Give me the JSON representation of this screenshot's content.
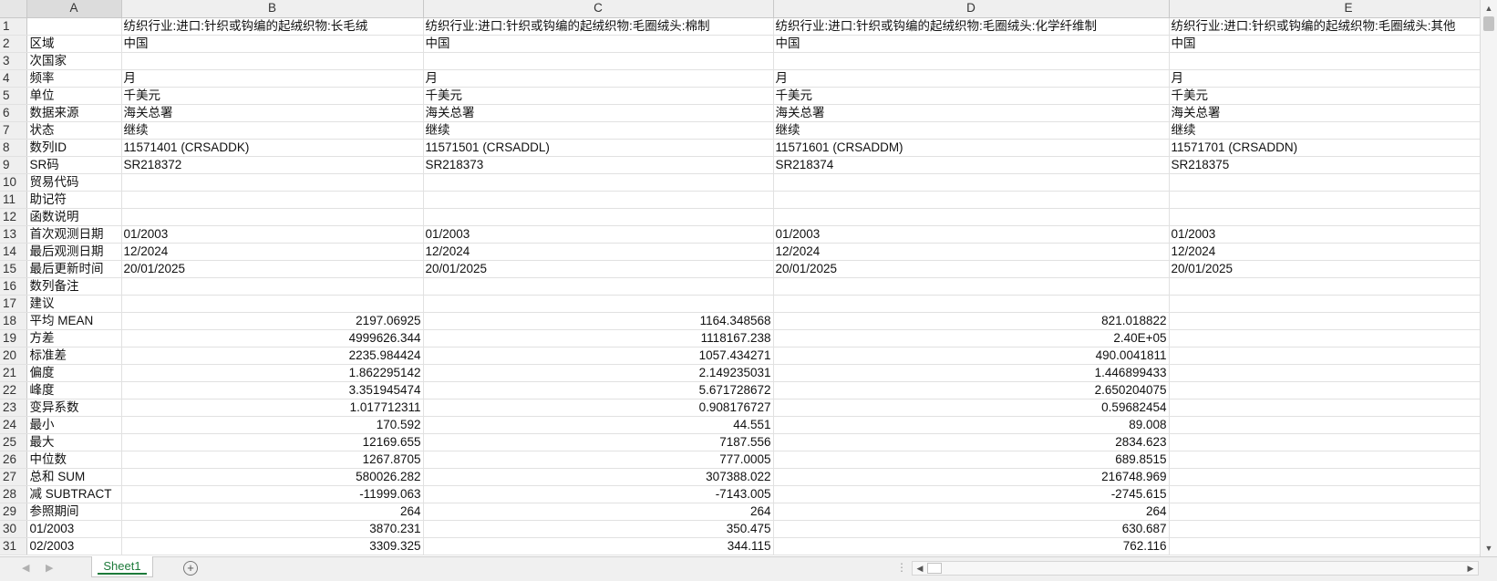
{
  "columns": [
    "A",
    "B",
    "C",
    "D",
    "E"
  ],
  "rows": [
    {
      "num": "1",
      "a": "",
      "b": "纺织行业:进口:针织或钩编的起绒织物:长毛绒",
      "c": "纺织行业:进口:针织或钩编的起绒织物:毛圈绒头:棉制",
      "d": "纺织行业:进口:针织或钩编的起绒织物:毛圈绒头:化学纤维制",
      "e": "纺织行业:进口:针织或钩编的起绒织物:毛圈绒头:其他"
    },
    {
      "num": "2",
      "a": "区域",
      "b": "中国",
      "c": "中国",
      "d": "中国",
      "e": "中国"
    },
    {
      "num": "3",
      "a": "次国家",
      "b": "",
      "c": "",
      "d": "",
      "e": ""
    },
    {
      "num": "4",
      "a": "频率",
      "b": "月",
      "c": "月",
      "d": "月",
      "e": "月"
    },
    {
      "num": "5",
      "a": "单位",
      "b": "千美元",
      "c": "千美元",
      "d": "千美元",
      "e": "千美元"
    },
    {
      "num": "6",
      "a": "数据来源",
      "b": "海关总署",
      "c": "海关总署",
      "d": "海关总署",
      "e": "海关总署"
    },
    {
      "num": "7",
      "a": "状态",
      "b": "继续",
      "c": "继续",
      "d": "继续",
      "e": "继续"
    },
    {
      "num": "8",
      "a": "数列ID",
      "b": "11571401 (CRSADDK)",
      "c": "11571501 (CRSADDL)",
      "d": "11571601 (CRSADDM)",
      "e": "11571701 (CRSADDN)"
    },
    {
      "num": "9",
      "a": "SR码",
      "b": "SR218372",
      "c": "SR218373",
      "d": "SR218374",
      "e": "SR218375"
    },
    {
      "num": "10",
      "a": "贸易代码",
      "b": "",
      "c": "",
      "d": "",
      "e": ""
    },
    {
      "num": "11",
      "a": "助记符",
      "b": "",
      "c": "",
      "d": "",
      "e": ""
    },
    {
      "num": "12",
      "a": "函数说明",
      "b": "",
      "c": "",
      "d": "",
      "e": ""
    },
    {
      "num": "13",
      "a": "首次观测日期",
      "b": "01/2003",
      "c": "01/2003",
      "d": "01/2003",
      "e": "01/2003"
    },
    {
      "num": "14",
      "a": "最后观测日期",
      "b": "12/2024",
      "c": "12/2024",
      "d": "12/2024",
      "e": "12/2024"
    },
    {
      "num": "15",
      "a": "最后更新时间",
      "b": "20/01/2025",
      "c": "20/01/2025",
      "d": "20/01/2025",
      "e": "20/01/2025"
    },
    {
      "num": "16",
      "a": "数列备注",
      "b": "",
      "c": "",
      "d": "",
      "e": ""
    },
    {
      "num": "17",
      "a": "建议",
      "b": "",
      "c": "",
      "d": "",
      "e": ""
    },
    {
      "num": "18",
      "a": "平均 MEAN",
      "b": "2197.06925",
      "c": "1164.348568",
      "d": "821.018822",
      "e": "",
      "numeric": true
    },
    {
      "num": "19",
      "a": "方差",
      "b": "4999626.344",
      "c": "1118167.238",
      "d": "2.40E+05",
      "e": "",
      "numeric": true
    },
    {
      "num": "20",
      "a": "标准差",
      "b": "2235.984424",
      "c": "1057.434271",
      "d": "490.0041811",
      "e": "",
      "numeric": true
    },
    {
      "num": "21",
      "a": "偏度",
      "b": "1.862295142",
      "c": "2.149235031",
      "d": "1.446899433",
      "e": "",
      "numeric": true
    },
    {
      "num": "22",
      "a": "峰度",
      "b": "3.351945474",
      "c": "5.671728672",
      "d": "2.650204075",
      "e": "",
      "numeric": true
    },
    {
      "num": "23",
      "a": "变异系数",
      "b": "1.017712311",
      "c": "0.908176727",
      "d": "0.59682454",
      "e": "",
      "numeric": true
    },
    {
      "num": "24",
      "a": "最小",
      "b": "170.592",
      "c": "44.551",
      "d": "89.008",
      "e": "",
      "numeric": true
    },
    {
      "num": "25",
      "a": "最大",
      "b": "12169.655",
      "c": "7187.556",
      "d": "2834.623",
      "e": "",
      "numeric": true
    },
    {
      "num": "26",
      "a": "中位数",
      "b": "1267.8705",
      "c": "777.0005",
      "d": "689.8515",
      "e": "",
      "numeric": true
    },
    {
      "num": "27",
      "a": "总和 SUM",
      "b": "580026.282",
      "c": "307388.022",
      "d": "216748.969",
      "e": "",
      "numeric": true
    },
    {
      "num": "28",
      "a": "减 SUBTRACT",
      "b": "-11999.063",
      "c": "-7143.005",
      "d": "-2745.615",
      "e": "",
      "numeric": true
    },
    {
      "num": "29",
      "a": "参照期间",
      "b": "264",
      "c": "264",
      "d": "264",
      "e": "",
      "numeric": true
    },
    {
      "num": "30",
      "a": "01/2003",
      "b": "3870.231",
      "c": "350.475",
      "d": "630.687",
      "e": "",
      "numeric": true
    },
    {
      "num": "31",
      "a": "02/2003",
      "b": "3309.325",
      "c": "344.115",
      "d": "762.116",
      "e": "",
      "numeric": true
    }
  ],
  "sheet_tab": "Sheet1",
  "icons": {
    "nav_prev": "◀",
    "nav_next": "▶",
    "add_sheet": "+",
    "scroll_up": "▲",
    "scroll_down": "▼",
    "scroll_left": "◀",
    "scroll_right": "▶",
    "more": "⋮"
  }
}
